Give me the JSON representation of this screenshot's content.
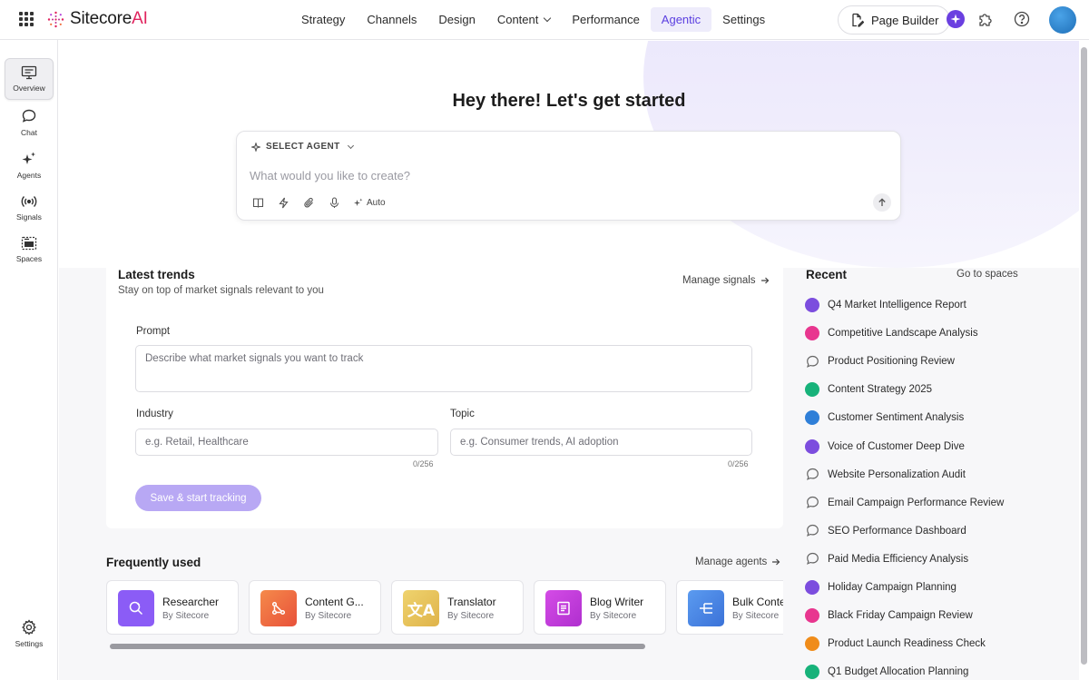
{
  "header": {
    "logo_text": "Sitecore",
    "logo_suffix": "AI",
    "nav": [
      {
        "label": "Strategy"
      },
      {
        "label": "Channels"
      },
      {
        "label": "Design"
      },
      {
        "label": "Content"
      },
      {
        "label": "Performance"
      },
      {
        "label": "Agentic"
      },
      {
        "label": "Settings"
      }
    ],
    "active_nav": "Agentic",
    "page_builder_label": "Page Builder"
  },
  "rail": {
    "items": [
      {
        "label": "Overview",
        "icon": "monitor-icon"
      },
      {
        "label": "Chat",
        "icon": "chat-icon"
      },
      {
        "label": "Agents",
        "icon": "sparkle-icon"
      },
      {
        "label": "Signals",
        "icon": "signal-icon"
      },
      {
        "label": "Spaces",
        "icon": "spaces-icon"
      }
    ],
    "settings_label": "Settings"
  },
  "hero": {
    "title": "Hey there! Let's get started",
    "select_agent": "SELECT AGENT",
    "placeholder": "What would you like to create?",
    "auto_label": "Auto"
  },
  "trends": {
    "title": "Latest trends",
    "subtitle": "Stay on top of market signals relevant to you",
    "manage_link": "Manage signals",
    "prompt_label": "Prompt",
    "prompt_placeholder": "Describe what market signals you want to track",
    "industry_label": "Industry",
    "industry_placeholder": "e.g. Retail, Healthcare",
    "industry_counter": "0/256",
    "topic_label": "Topic",
    "topic_placeholder": "e.g. Consumer trends, AI adoption",
    "topic_counter": "0/256",
    "save_button": "Save & start tracking"
  },
  "frequent": {
    "title": "Frequently used",
    "manage_link": "Manage agents",
    "agents": [
      {
        "name": "Researcher",
        "by": "By Sitecore",
        "color": "#8b5cf6"
      },
      {
        "name": "Content G...",
        "by": "By Sitecore",
        "color": "#f07845"
      },
      {
        "name": "Translator",
        "by": "By Sitecore",
        "color": "#e6c55a"
      },
      {
        "name": "Blog Writer",
        "by": "By Sitecore",
        "color": "#c33fd9"
      },
      {
        "name": "Bulk Conte",
        "by": "By Sitecore",
        "color": "#4a86e8"
      }
    ]
  },
  "recent": {
    "title": "Recent",
    "go_link": "Go to spaces",
    "items": [
      {
        "label": "Q4 Market Intelligence Report",
        "kind": "dot",
        "color": "#7c4dde"
      },
      {
        "label": "Competitive Landscape Analysis",
        "kind": "dot",
        "color": "#e8368f"
      },
      {
        "label": "Product Positioning Review",
        "kind": "chat",
        "color": "#666666"
      },
      {
        "label": "Content Strategy 2025",
        "kind": "dot",
        "color": "#17b27a"
      },
      {
        "label": "Customer Sentiment Analysis",
        "kind": "dot",
        "color": "#2f7fd8"
      },
      {
        "label": "Voice of Customer Deep Dive",
        "kind": "dot",
        "color": "#7c4dde"
      },
      {
        "label": "Website Personalization Audit",
        "kind": "chat",
        "color": "#666666"
      },
      {
        "label": "Email Campaign Performance Review",
        "kind": "chat",
        "color": "#666666"
      },
      {
        "label": "SEO Performance Dashboard",
        "kind": "chat",
        "color": "#666666"
      },
      {
        "label": "Paid Media Efficiency Analysis",
        "kind": "chat",
        "color": "#666666"
      },
      {
        "label": "Holiday Campaign Planning",
        "kind": "dot",
        "color": "#7c4dde"
      },
      {
        "label": "Black Friday Campaign Review",
        "kind": "dot",
        "color": "#e8368f"
      },
      {
        "label": "Product Launch Readiness Check",
        "kind": "dot",
        "color": "#f08c1a"
      },
      {
        "label": "Q1 Budget Allocation Planning",
        "kind": "dot",
        "color": "#17b27a"
      }
    ]
  },
  "colors": {
    "accent": "#5a3ee0",
    "accent_bg": "#eeecfb",
    "save_button": "#b8a8f4"
  }
}
